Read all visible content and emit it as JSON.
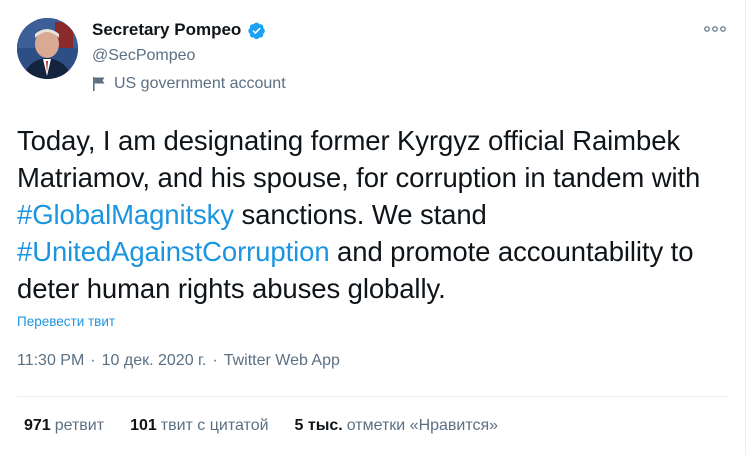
{
  "user": {
    "display_name": "Secretary Pompeo",
    "handle": "@SecPompeo",
    "label": "US government account"
  },
  "tweet": {
    "segments": [
      {
        "text": "Today, I am designating former Kyrgyz official Raimbek Matriamov, and his spouse, for corruption in tandem with ",
        "type": "text"
      },
      {
        "text": "#GlobalMagnitsky",
        "type": "hashtag"
      },
      {
        "text": " sanctions. We stand ",
        "type": "text"
      },
      {
        "text": "#UnitedAgainstCorruption",
        "type": "hashtag"
      },
      {
        "text": " and promote accountability to deter human rights abuses globally.",
        "type": "text"
      }
    ],
    "translate_label": "Перевести твит",
    "time": "11:30 PM",
    "separator": "·",
    "date": "10 дек. 2020 г.",
    "app": "Twitter Web App"
  },
  "stats": {
    "retweets_count": "971",
    "retweets_label": "ретвит",
    "quotes_count": "101",
    "quotes_label": "твит с цитатой",
    "likes_count": "5 тыс.",
    "likes_label": "отметки «Нравится»"
  },
  "colors": {
    "link": "#1b95e0",
    "secondary_text": "#5b7083",
    "verified_badge": "#1da1f2"
  },
  "icons": [
    "verified-badge-icon",
    "flag-icon",
    "more-options-icon"
  ]
}
